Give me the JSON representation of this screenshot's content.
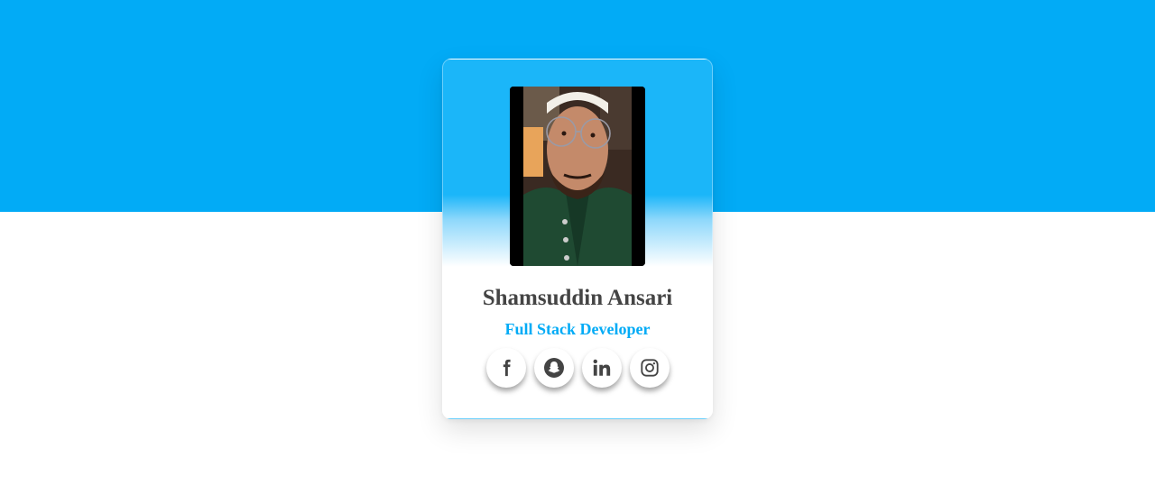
{
  "profile": {
    "name": "Shamsuddin Ansari",
    "role": "Full Stack Developer",
    "photo_alt": "profile photo"
  },
  "socials": [
    {
      "network": "Facebook",
      "icon": "facebook-icon"
    },
    {
      "network": "Snapchat",
      "icon": "snapchat-icon"
    },
    {
      "network": "LinkedIn",
      "icon": "linkedin-icon"
    },
    {
      "network": "Instagram",
      "icon": "instagram-icon"
    }
  ],
  "colors": {
    "accent": "#02abf6",
    "name_text": "#444444",
    "icon": "#444444",
    "background": "#ffffff"
  }
}
